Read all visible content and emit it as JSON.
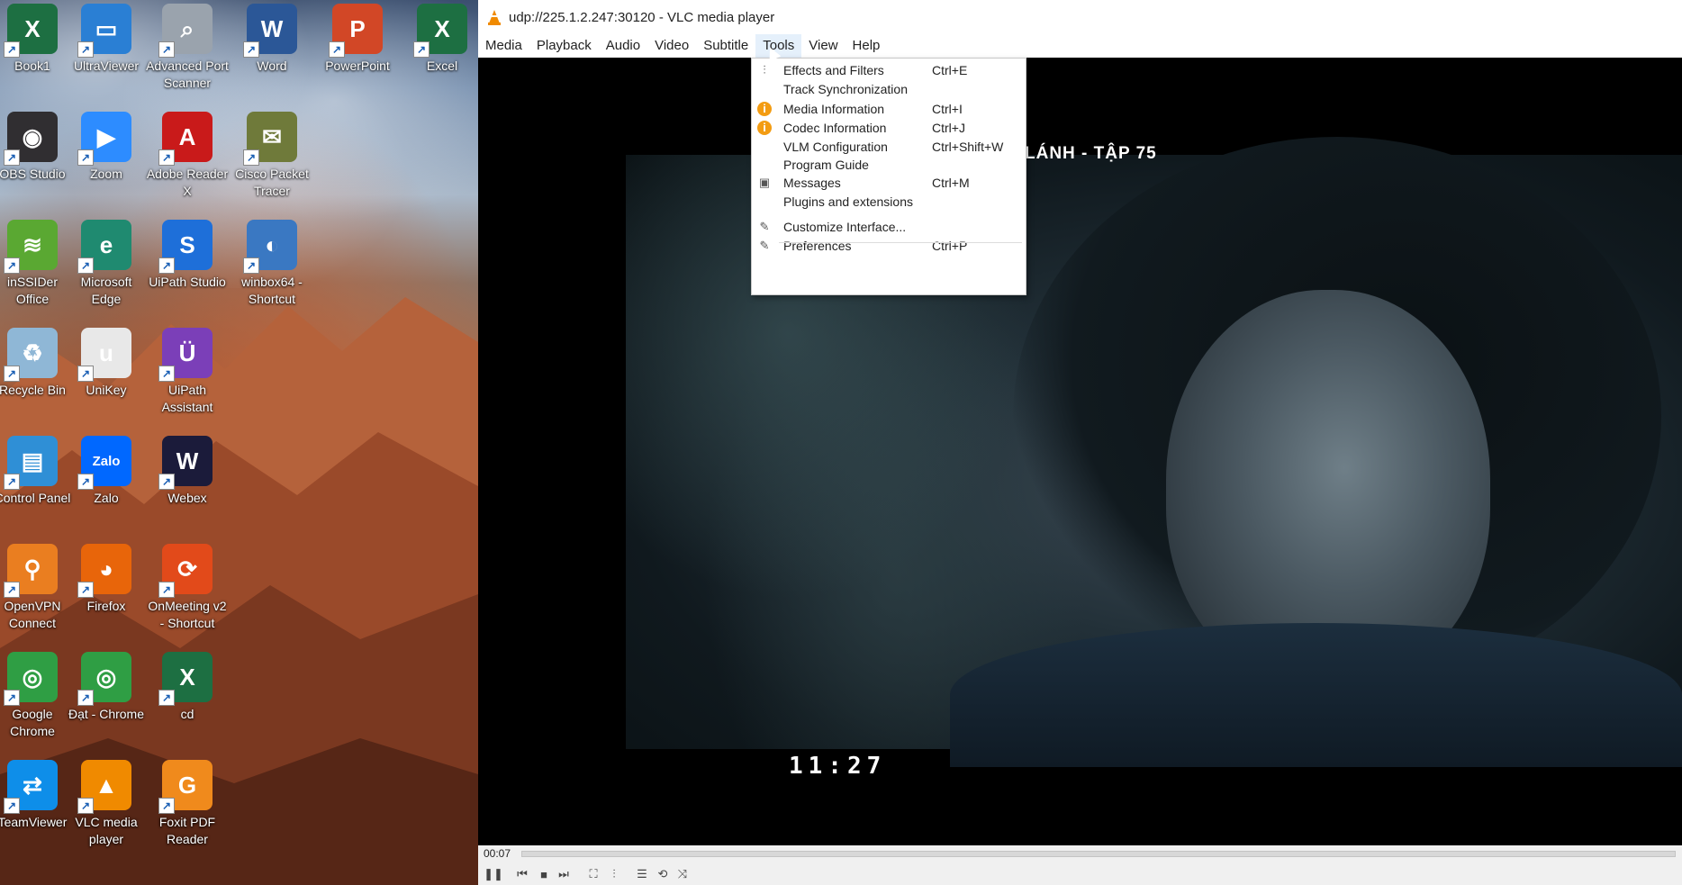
{
  "desktop": {
    "icons": [
      {
        "label": "Book1",
        "icon": "excel-file-icon",
        "color": "#1d6f42",
        "glyph": "X"
      },
      {
        "label": "UltraViewer",
        "icon": "ultraviewer-icon",
        "color": "#2a7fd4",
        "glyph": "▭"
      },
      {
        "label": "Advanced Port Scanner",
        "icon": "port-scanner-icon",
        "color": "#9aa3ad",
        "glyph": "⌕"
      },
      {
        "label": "Word",
        "icon": "word-icon",
        "color": "#2b5797",
        "glyph": "W"
      },
      {
        "label": "PowerPoint",
        "icon": "powerpoint-icon",
        "color": "#d24726",
        "glyph": "P"
      },
      {
        "label": "Excel",
        "icon": "excel-icon",
        "color": "#1d6f42",
        "glyph": "X"
      },
      {
        "label": "OBS Studio",
        "icon": "obs-icon",
        "color": "#302e31",
        "glyph": "◉"
      },
      {
        "label": "Zoom",
        "icon": "zoom-icon",
        "color": "#2d8cff",
        "glyph": "▶"
      },
      {
        "label": "Adobe Reader X",
        "icon": "adobe-reader-icon",
        "color": "#c91a1a",
        "glyph": "A"
      },
      {
        "label": "Cisco Packet Tracer",
        "icon": "cisco-packet-tracer-icon",
        "color": "#6f7a3a",
        "glyph": "✉"
      },
      {
        "label": "inSSIDer Office",
        "icon": "inssider-icon",
        "color": "#5aa832",
        "glyph": "≋"
      },
      {
        "label": "Microsoft Edge",
        "icon": "edge-icon",
        "color": "#1f8a70",
        "glyph": "e"
      },
      {
        "label": "UiPath Studio",
        "icon": "uipath-studio-icon",
        "color": "#1e6fd9",
        "glyph": "S"
      },
      {
        "label": "winbox64 - Shortcut",
        "icon": "winbox-icon",
        "color": "#3a78c2",
        "glyph": "◐"
      },
      {
        "label": "Recycle Bin",
        "icon": "recycle-bin-icon",
        "color": "#8fb7d6",
        "glyph": "♻"
      },
      {
        "label": "UniKey",
        "icon": "unikey-icon",
        "color": "#e8e8e8",
        "glyph": "u"
      },
      {
        "label": "UiPath Assistant",
        "icon": "uipath-assistant-icon",
        "color": "#7b3fb8",
        "glyph": "Ü"
      },
      {
        "label": "Control Panel",
        "icon": "control-panel-icon",
        "color": "#2f8fd6",
        "glyph": "▤"
      },
      {
        "label": "Zalo",
        "icon": "zalo-icon",
        "color": "#0068ff",
        "glyph": "Zalo"
      },
      {
        "label": "Webex",
        "icon": "webex-icon",
        "color": "#1b1b3a",
        "glyph": "W"
      },
      {
        "label": "OpenVPN Connect",
        "icon": "openvpn-icon",
        "color": "#ea7e20",
        "glyph": "⚲"
      },
      {
        "label": "Firefox",
        "icon": "firefox-icon",
        "color": "#e8650a",
        "glyph": "◕"
      },
      {
        "label": "OnMeeting v2 - Shortcut",
        "icon": "onmeeting-icon",
        "color": "#e24a1a",
        "glyph": "⟳"
      },
      {
        "label": "Google Chrome",
        "icon": "chrome-icon",
        "color": "#2f9e44",
        "glyph": "◎"
      },
      {
        "label": "Đạt - Chrome",
        "icon": "chrome-profile-icon",
        "color": "#2f9e44",
        "glyph": "◎"
      },
      {
        "label": "cd",
        "icon": "excel-file-icon",
        "color": "#1d6f42",
        "glyph": "X"
      },
      {
        "label": "TeamViewer",
        "icon": "teamviewer-icon",
        "color": "#0e8ee9",
        "glyph": "⇄"
      },
      {
        "label": "VLC media player",
        "icon": "vlc-icon",
        "color": "#f08a00",
        "glyph": "▲"
      },
      {
        "label": "Foxit PDF Reader",
        "icon": "foxit-icon",
        "color": "#f08a1c",
        "glyph": "G"
      }
    ]
  },
  "vlc": {
    "title": "udp://225.1.2.247:30120 - VLC media player",
    "menu": [
      "Media",
      "Playback",
      "Audio",
      "Video",
      "Subtitle",
      "Tools",
      "View",
      "Help"
    ],
    "active_menu": "Tools",
    "video": {
      "overlay_title": "LÁNH - TẬP 75",
      "timestamp": "11:27"
    },
    "elapsed": "00:07",
    "progress_fraction": 0.0,
    "tools_menu": [
      {
        "label": "Effects and Filters",
        "shortcut": "Ctrl+E",
        "icon": "equalizer-icon"
      },
      {
        "label": "Track Synchronization",
        "shortcut": "",
        "icon": ""
      },
      {
        "label": "Media Information",
        "shortcut": "Ctrl+I",
        "icon": "info-icon"
      },
      {
        "label": "Codec Information",
        "shortcut": "Ctrl+J",
        "icon": "info-icon"
      },
      {
        "label": "VLM Configuration",
        "shortcut": "Ctrl+Shift+W",
        "icon": ""
      },
      {
        "label": "Program Guide",
        "shortcut": "",
        "icon": ""
      },
      {
        "label": "Messages",
        "shortcut": "Ctrl+M",
        "icon": "terminal-icon"
      },
      {
        "label": "Plugins and extensions",
        "shortcut": "",
        "icon": ""
      },
      {
        "label": "Customize Interface...",
        "shortcut": "",
        "icon": "wrench-icon"
      },
      {
        "label": "Preferences",
        "shortcut": "Ctrl+P",
        "icon": "wrench-icon"
      }
    ]
  }
}
